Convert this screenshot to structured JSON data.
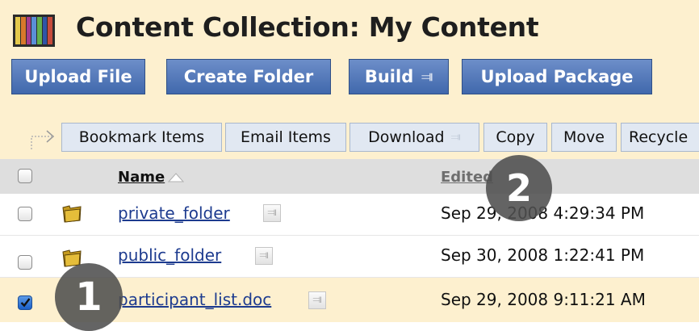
{
  "header": {
    "title": "Content Collection: My Content",
    "icon": "books-icon"
  },
  "toolbar": {
    "upload_file": "Upload File",
    "create_folder": "Create Folder",
    "build": "Build",
    "upload_package": "Upload Package"
  },
  "actions": {
    "bookmark": "Bookmark Items",
    "email": "Email Items",
    "download": "Download",
    "copy": "Copy",
    "move": "Move",
    "recycle": "Recycle"
  },
  "table": {
    "columns": {
      "name": "Name",
      "edited": "Edited"
    },
    "rows": [
      {
        "name": "private_folder",
        "date": "Sep 29, 2008 4:29:34 PM",
        "type": "folder",
        "checked": false
      },
      {
        "name": "public_folder",
        "date": "Sep 30, 2008 1:22:41 PM",
        "type": "folder",
        "checked": false
      },
      {
        "name": "participant_list.doc",
        "date": "Sep 29, 2008 9:11:21 AM",
        "type": "document",
        "checked": true
      }
    ]
  },
  "callouts": [
    "1",
    "2"
  ],
  "colors": {
    "header_bg": "#fdf0cf",
    "button_blue": "#4a72b6",
    "link_blue": "#1d3b8f",
    "callout": "#4e4e4e"
  }
}
